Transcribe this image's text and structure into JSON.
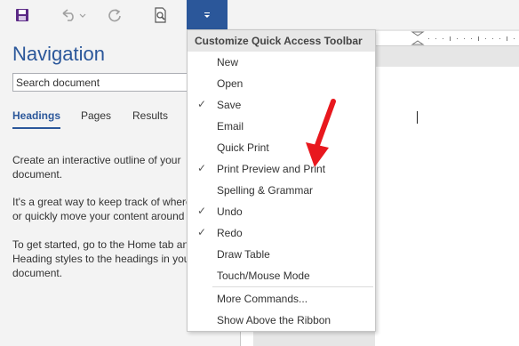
{
  "qat": {
    "save_icon": "save-icon",
    "undo_icon": "undo-icon",
    "redo_icon": "redo-icon",
    "print_preview_icon": "print-preview-icon",
    "dropdown_icon": "customize-dropdown-icon"
  },
  "nav": {
    "title": "Navigation",
    "search_value": "Search document",
    "tabs": [
      "Headings",
      "Pages",
      "Results"
    ],
    "para1_line1": "Create an interactive outline of your",
    "para1_line2": "document.",
    "para2_line1": "It's a great way to keep track of where",
    "para2_line2": "or quickly move your content around",
    "para3_line1": "To get started, go to the Home tab an",
    "para3_line2": "Heading styles to the headings in you",
    "para3_line3": "document."
  },
  "menu": {
    "header": "Customize Quick Access Toolbar",
    "items": [
      {
        "label": "New",
        "checked": false
      },
      {
        "label": "Open",
        "checked": false
      },
      {
        "label": "Save",
        "checked": true
      },
      {
        "label": "Email",
        "checked": false
      },
      {
        "label": "Quick Print",
        "checked": false
      },
      {
        "label": "Print Preview and Print",
        "checked": true
      },
      {
        "label": "Spelling & Grammar",
        "checked": false
      },
      {
        "label": "Undo",
        "checked": true
      },
      {
        "label": "Redo",
        "checked": true
      },
      {
        "label": "Draw Table",
        "checked": false
      },
      {
        "label": "Touch/Mouse Mode",
        "checked": false
      }
    ],
    "more_commands": "More Commands...",
    "show_above": "Show Above the Ribbon",
    "check_glyph": "✓"
  },
  "colors": {
    "accent": "#2b579a",
    "annotation_arrow": "#e8181e"
  }
}
